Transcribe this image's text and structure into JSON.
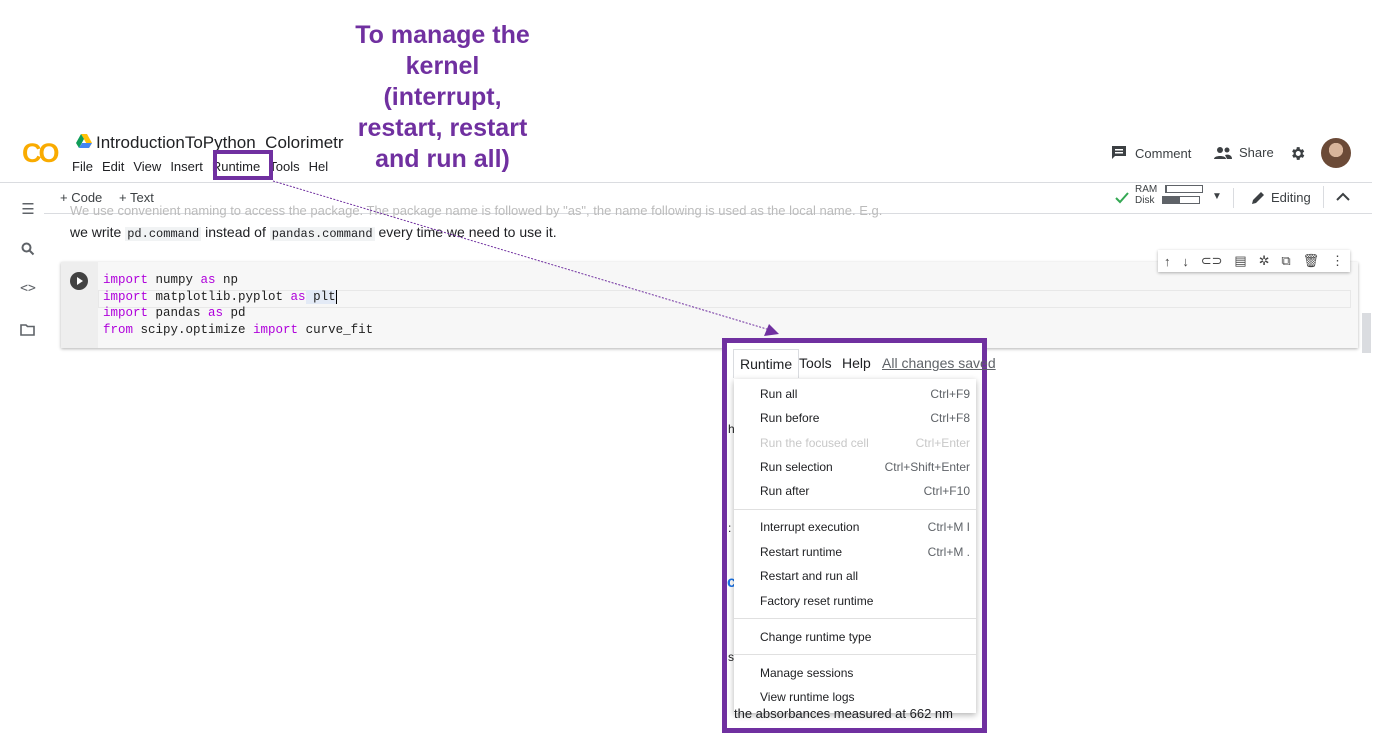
{
  "annotation": {
    "text_lines": [
      "To manage the",
      "kernel",
      "(interrupt,",
      "restart, restart",
      "and run all)"
    ]
  },
  "header": {
    "logo": "CO",
    "title": "IntroductionToPython_Colorimetri",
    "menu": [
      "File",
      "Edit",
      "View",
      "Insert",
      "Runtime",
      "Tools",
      "Hel"
    ],
    "comment_label": "Comment",
    "share_label": "Share"
  },
  "toolbar": {
    "add_code": "+ Code",
    "add_text": "+ Text",
    "ram_label": "RAM",
    "disk_label": "Disk",
    "ram_fraction": 0.03,
    "disk_fraction": 0.45,
    "editing_label": "Editing"
  },
  "text_cell": {
    "faded_line": "We use convenient naming to access the package. The package name is followed by \"as\", the name following is used as the local name. E.g.",
    "line_prefix": "we write ",
    "code1": "pd.command",
    "middle": " instead of ",
    "code2": "pandas.command",
    "suffix": " every time we need to use it."
  },
  "code_cell": {
    "lines": [
      {
        "kw1": "import",
        "mid": " numpy ",
        "kw2": "as",
        "end": " np"
      },
      {
        "kw1": "import",
        "mid": " matplotlib.pyplot ",
        "kw2": "as",
        "end": " plt"
      },
      {
        "kw1": "import",
        "mid": " pandas ",
        "kw2": "as",
        "end": " pd"
      },
      {
        "kw1": "from",
        "mid": " scipy.optimize ",
        "kw2": "import",
        "end": " curve_fit"
      }
    ]
  },
  "menu_zoom": {
    "top_tabs": [
      "Runtime",
      "Tools",
      "Help"
    ],
    "saved": "All changes saved",
    "items": [
      {
        "label": "Run all",
        "shortcut": "Ctrl+F9",
        "disabled": false
      },
      {
        "label": "Run before",
        "shortcut": "Ctrl+F8",
        "disabled": false
      },
      {
        "label": "Run the focused cell",
        "shortcut": "Ctrl+Enter",
        "disabled": true
      },
      {
        "label": "Run selection",
        "shortcut": "Ctrl+Shift+Enter",
        "disabled": false
      },
      {
        "label": "Run after",
        "shortcut": "Ctrl+F10",
        "disabled": false
      },
      {
        "label": "Interrupt execution",
        "shortcut": "Ctrl+M I",
        "disabled": false
      },
      {
        "label": "Restart runtime",
        "shortcut": "Ctrl+M .",
        "disabled": false
      },
      {
        "label": "Restart and run all",
        "shortcut": "",
        "disabled": false
      },
      {
        "label": "Factory reset runtime",
        "shortcut": "",
        "disabled": false
      },
      {
        "label": "Change runtime type",
        "shortcut": "",
        "disabled": false
      },
      {
        "label": "Manage sessions",
        "shortcut": "",
        "disabled": false
      },
      {
        "label": "View runtime logs",
        "shortcut": "",
        "disabled": false
      }
    ],
    "bottom_text": "the absorbances measured at 662 nm"
  }
}
